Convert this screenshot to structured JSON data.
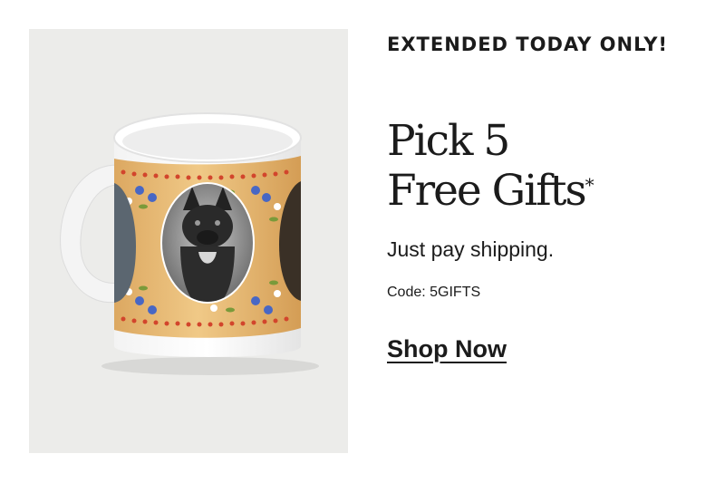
{
  "promo": {
    "eyebrow": "EXTENDED TODAY ONLY!",
    "headline_line1": "Pick 5",
    "headline_line2": "Free Gifts",
    "footnote_mark": "*",
    "subhead": "Just pay shipping.",
    "code_text": "Code: 5GIFTS",
    "cta_label": "Shop Now"
  },
  "image": {
    "subject": "custom photo mug with french bulldog photos and floral border",
    "colors": {
      "background": "#ececea",
      "mug_white": "#ffffff",
      "wrap_gold": "#e8bd78",
      "flower_red": "#d2452c",
      "flower_blue": "#4867c4",
      "leaf_green": "#7a9a3a"
    }
  }
}
